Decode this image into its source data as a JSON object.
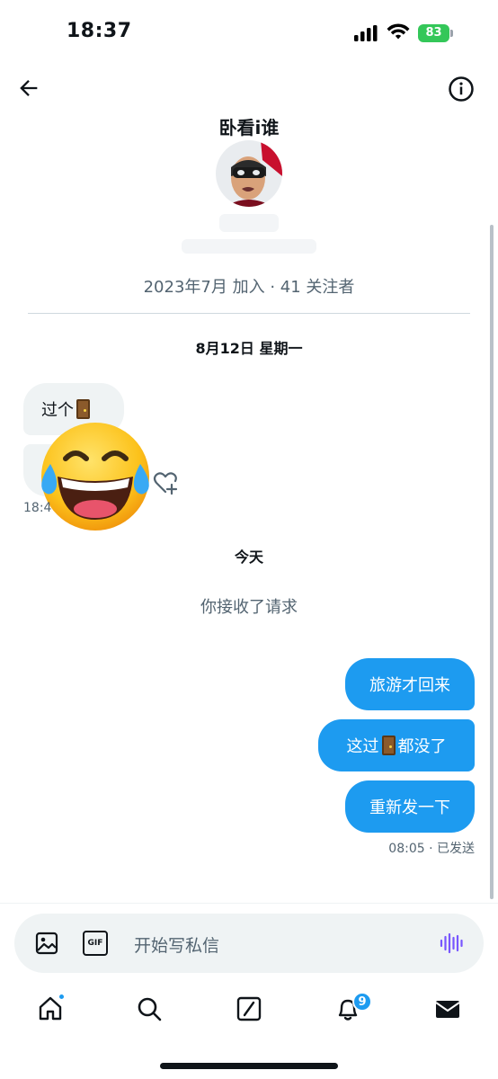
{
  "status_bar": {
    "time": "18:37",
    "battery": "83",
    "icons": [
      "signal-icon",
      "wifi-icon",
      "battery-icon"
    ]
  },
  "header": {
    "back_icon": "arrow-left-icon",
    "info_icon": "info-icon"
  },
  "profile": {
    "name": "卧看i谁",
    "meta": "2023年7月 加入 · 41 关注者"
  },
  "conversation": {
    "date_1": "8月12日 星期一",
    "incoming": [
      {
        "text_before": "过个",
        "text_after": "",
        "emoji": "door"
      }
    ],
    "incoming_time": "18:4",
    "reaction_emoji": "face-with-tears-of-joy",
    "date_2": "今天",
    "system_message": "你接收了请求",
    "outgoing": [
      {
        "text_before": "旅游才回来",
        "text_after": ""
      },
      {
        "text_before": "这过",
        "text_after": "都没了",
        "emoji": "door"
      },
      {
        "text_before": "重新发一下",
        "text_after": ""
      }
    ],
    "outgoing_status": "08:05 · 已发送"
  },
  "composer": {
    "placeholder": "开始写私信",
    "icons": [
      "image-icon",
      "gif-icon",
      "voice-icon"
    ],
    "gif_label": "GIF"
  },
  "tabbar": {
    "items": [
      "home-icon",
      "search-icon",
      "grok-icon",
      "notifications-icon",
      "messages-icon"
    ],
    "notification_count": "9"
  },
  "colors": {
    "accent": "#1d9bf0",
    "bubble_incoming": "#eff3f4",
    "muted_text": "#536471",
    "battery": "#34c759"
  }
}
